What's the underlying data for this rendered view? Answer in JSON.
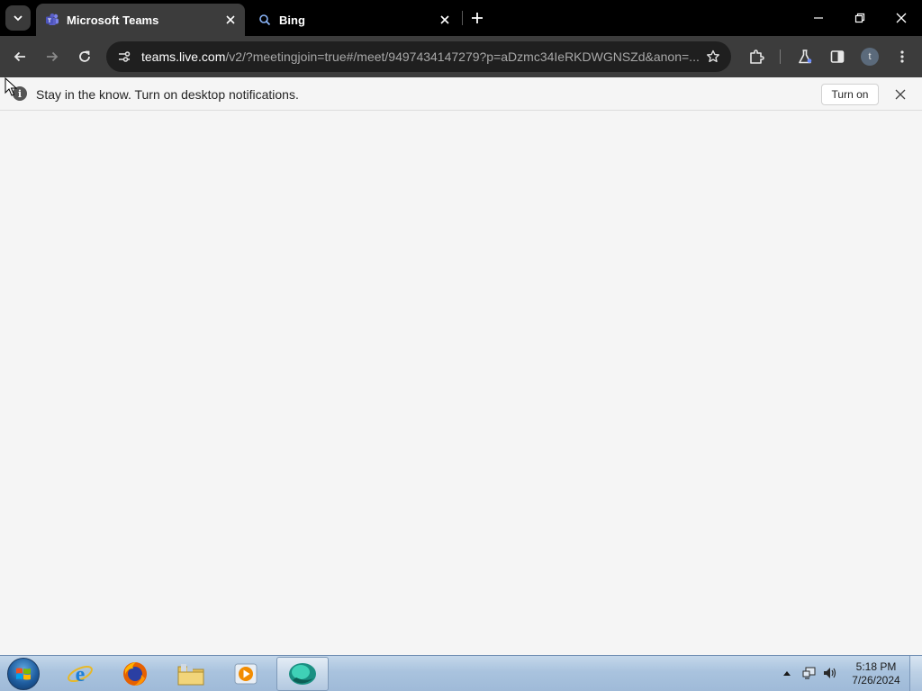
{
  "browser": {
    "tabs": [
      {
        "title": "Microsoft Teams",
        "icon": "teams-icon",
        "active": true
      },
      {
        "title": "Bing",
        "icon": "search-icon",
        "active": false
      }
    ],
    "address_bar": {
      "host": "teams.live.com",
      "path": "/v2/?meetingjoin=true#/meet/9497434147279?p=aDzmc34IeRKDWGNSZd&anon=..."
    },
    "profile_initial": "t"
  },
  "notification": {
    "text": "Stay in the know. Turn on desktop notifications.",
    "button_label": "Turn on",
    "icon": "info-icon"
  },
  "taskbar": {
    "apps": [
      "internet-explorer-icon",
      "firefox-icon",
      "file-explorer-icon",
      "media-player-icon",
      "teams-app-icon"
    ],
    "clock": {
      "time": "5:18 PM",
      "date": "7/26/2024"
    }
  },
  "colors": {
    "tabstrip": "#000000",
    "toolbar": "#3c3c3c",
    "omnibox": "#1f1f1f",
    "page_background": "#f5f5f5",
    "teams_purple": "#5b5fc7"
  }
}
